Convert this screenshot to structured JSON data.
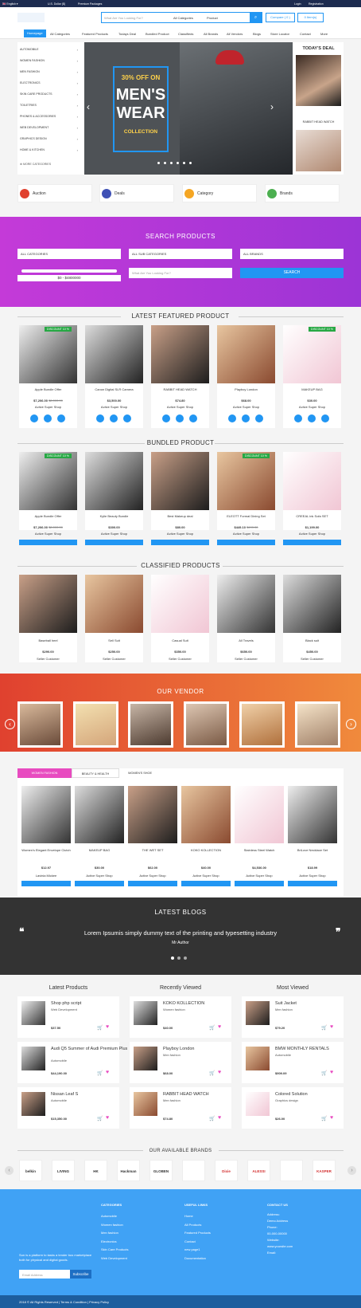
{
  "topbar": {
    "language": "English",
    "currency": "U.S. Dollar ($)",
    "promo": "Premium Packages",
    "login": "Login",
    "register": "Registration"
  },
  "search": {
    "placeholder": "What Are You Looking For?",
    "category": "All Categories",
    "type": "Product",
    "compare": "Compare ( 0 )",
    "cart": "0 Item(s)"
  },
  "nav": [
    "Homepage",
    "All Categories",
    "Featured Products",
    "Todays Deal",
    "Bundled Product",
    "Classifieds",
    "All Brands",
    "All Vendors",
    "Blogs",
    "Store Locator",
    "Contact",
    "More"
  ],
  "categories": [
    "AUTOMOBILE",
    "WOMEN FASHION",
    "MEN FASHION",
    "ELECTRONICS",
    "SKIN CARE PRODUCTS",
    "TOILETRIES",
    "PHONES & ACCESSORIES",
    "WEB DEVELOPMENT",
    "GRAPHICS DESIGN",
    "HOME & KITCHEN"
  ],
  "more_categories": "MORE CATEGORIES",
  "hero": {
    "line1": "30% OFF ON",
    "line2": "MEN'S",
    "line3": "WEAR",
    "line4": "COLLECTION"
  },
  "todays_deal": {
    "title": "TODAY'S DEAL",
    "item": "RABBIT HEAD WATCH"
  },
  "features": [
    "Auction",
    "Deals",
    "Category",
    "Brands"
  ],
  "search_products": {
    "title": "SEARCH PRODUCTS",
    "cat": "ALL CATEGORIES",
    "subcat": "ALL SUB CATEGORIES",
    "brand": "ALL BRANDS",
    "range": "$0 - $4800000",
    "placeholder": "What Are You Looking For?",
    "button": "SEARCH"
  },
  "featured": {
    "title": "LATEST FEATURED PRODUCT",
    "items": [
      {
        "name": "Apple Bundle Offer",
        "price": "$7,206.00",
        "old": "$8,000.00",
        "shop": "Active Super Shop",
        "badge": "DISCOUNT 10 %"
      },
      {
        "name": "Canon Digital SLR Camera",
        "price": "$3,500.00",
        "old": "",
        "shop": "Active Super Shop",
        "badge": ""
      },
      {
        "name": "RABBIT HEAD WATCH",
        "price": "$74.80",
        "old": "",
        "shop": "Active Super Shop",
        "badge": ""
      },
      {
        "name": "Playboy London",
        "price": "$68.00",
        "old": "",
        "shop": "Active Super Shop",
        "badge": ""
      },
      {
        "name": "MAKEUP BAG",
        "price": "$30.00",
        "old": "",
        "shop": "Active Super Shop",
        "badge": "DISCOUNT 10 %"
      }
    ]
  },
  "bundled": {
    "title": "BUNDLED PRODUCT",
    "items": [
      {
        "name": "Apple Bundle Offer",
        "price": "$7,206.00",
        "old": "$8,000.00",
        "shop": "Active Super Shop",
        "badge": "DISCOUNT 10 %"
      },
      {
        "name": "Kylie Beauty Bundle",
        "price": "$300.00",
        "old": "",
        "shop": "Active Super Shop",
        "badge": ""
      },
      {
        "name": "Best Makeup deal",
        "price": "$80.00",
        "old": "",
        "shop": "Active Super Shop",
        "badge": ""
      },
      {
        "name": "ELEOTT Formal Dining Set",
        "price": "$449.10",
        "old": "$499.00",
        "shop": "Active Super Shop",
        "badge": "DISCOUNT 10 %"
      },
      {
        "name": "CREEAL ink Sofa SET",
        "price": "$1,199.00",
        "old": "",
        "shop": "Active Super Shop",
        "badge": ""
      }
    ]
  },
  "classified": {
    "title": "CLASSIFIED PRODUCTS",
    "items": [
      {
        "name": "Baseball heel",
        "price": "$290.00",
        "shop": "Seller Customer"
      },
      {
        "name": "Sell Suit",
        "price": "$250.00",
        "shop": "Seller Customer"
      },
      {
        "name": "Casual Suit",
        "price": "$350.00",
        "shop": "Seller Customer"
      },
      {
        "name": "All Travels",
        "price": "$650.00",
        "shop": "Seller Customer"
      },
      {
        "name": "Black suit",
        "price": "$450.00",
        "shop": "Seller Customer"
      }
    ]
  },
  "vendor_title": "OUR VENDOR",
  "tabs": [
    "WOMEN FASHION",
    "BEAUTY & HEALTH",
    "WOMEN'S SHOE"
  ],
  "tab_items": [
    {
      "name": "Women's Elegant Envelope Clutch",
      "price": "$12.97",
      "shop": "Lavinia Mickee"
    },
    {
      "name": "MAKEUP BAG",
      "price": "$30.00",
      "shop": "Active Super Shop"
    },
    {
      "name": "THE WET SET",
      "price": "$62.00",
      "shop": "Active Super Shop"
    },
    {
      "name": "KOKO KOLLECTION",
      "price": "$40.00",
      "shop": "Active Super Shop"
    },
    {
      "name": "Stainless Steel Watch",
      "price": "$4,536.00",
      "shop": "Active Super Shop"
    },
    {
      "name": "BriLove Necklace Set",
      "price": "$18.99",
      "shop": "Active Super Shop"
    }
  ],
  "blogs": {
    "title": "LATEST BLOGS",
    "quote": "Lorem Ipsumis simply dummy text of the printing and typesetting industry",
    "author": "Mr Author"
  },
  "lists": [
    {
      "title": "Latest Products",
      "items": [
        {
          "name": "Shop php script",
          "cat": "Web Development",
          "price": "$37.50"
        },
        {
          "name": "Audi Q5 Summer of Audi Premium Plus",
          "cat": "Automobile",
          "price": "$44,190.00"
        },
        {
          "name": "Nissan Leaf S",
          "cat": "Automobile",
          "price": "$15,350.00"
        }
      ]
    },
    {
      "title": "Recently Viewed",
      "items": [
        {
          "name": "KOKO KOLLECTION",
          "cat": "Women fashion",
          "price": "$40.00"
        },
        {
          "name": "Playboy London",
          "cat": "Men fashion",
          "price": "$68.00"
        },
        {
          "name": "RABBIT HEAD WATCH",
          "cat": "Men fashion",
          "price": "$74.80"
        }
      ]
    },
    {
      "title": "Most Viewed",
      "items": [
        {
          "name": "Suit Jacket",
          "cat": "Men fashion",
          "price": "$79.20"
        },
        {
          "name": "BMW MONTHLY RENTALS",
          "cat": "Automobile",
          "price": "$909.09"
        },
        {
          "name": "Colored Solution",
          "cat": "Graphics design",
          "price": "$26.00"
        }
      ]
    }
  ],
  "brands_title": "OUR AVAILABLE BRANDS",
  "brands": [
    "belkin",
    "LIVING",
    "HK",
    "Hackman",
    "GLOBEN",
    "",
    "Dixie",
    "ALESSI",
    "",
    "KASPER"
  ],
  "footer": {
    "about": "Sun is a platform to tasks a tender bus marketplace both for physical and digital goods.",
    "email_placeholder": "Email Address",
    "subscribe": "Subscribe",
    "categories_title": "CATEGORIES",
    "categories": [
      "Automobile",
      "Women fashion",
      "Men fashion",
      "Electronics",
      "Skin Care Products",
      "Web Development"
    ],
    "links_title": "USEFUL LINKS",
    "links": [
      "Home",
      "All Products",
      "Featured Products",
      "Contact",
      "new page1",
      "Documentation"
    ],
    "contact_title": "CONTACT US",
    "contact": [
      "Address:",
      "Demo Address",
      "Phone:",
      "00-000-00000",
      "Website:",
      "www.yoursite.com",
      "Email:"
    ],
    "copyright": "2018 © All Rights Reserved | Terms & Condition | Privacy Policy"
  }
}
